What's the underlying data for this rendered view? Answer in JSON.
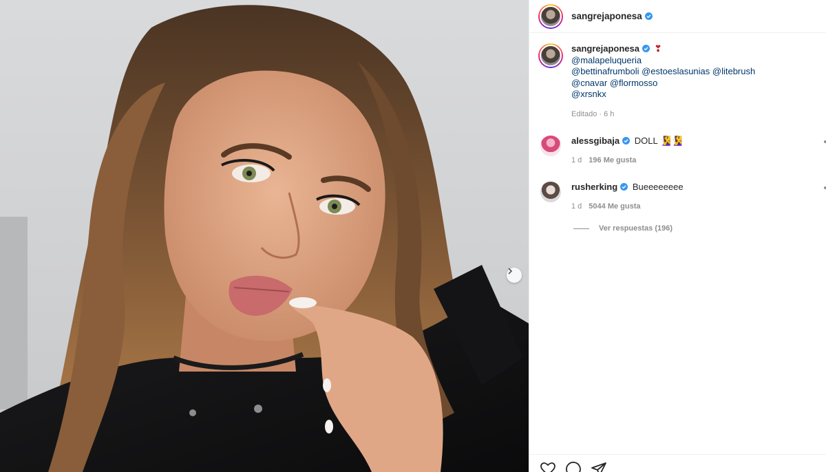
{
  "post": {
    "username": "sangrejaponesa",
    "caption": {
      "emoji": "❣",
      "lines": [
        "@malapeluqueria",
        "@bettinafrumboli @estoeslasunias @litebrush",
        "@cnavar @flormosso",
        "@xrsnkx"
      ],
      "edited_time": "Editado · 6 h"
    }
  },
  "comments": [
    {
      "username": "alessgibaja",
      "text": "DOLL 🧏‍♀️🧏‍♀️",
      "time": "1 d",
      "likes": "196 Me gusta"
    },
    {
      "username": "rusherking",
      "text": "Bueeeeeeee",
      "time": "1 d",
      "likes": "5044 Me gusta"
    }
  ],
  "replies_link": "Ver respuestas (196)",
  "icons": {
    "like": "heart-icon",
    "comment": "comment-icon",
    "share": "send-icon",
    "verified": "verified-badge-icon",
    "next": "chevron-right-icon"
  },
  "colors": {
    "link": "#00376b",
    "verified": "#3897f0",
    "muted": "#8e8e8e",
    "text": "#262626"
  }
}
